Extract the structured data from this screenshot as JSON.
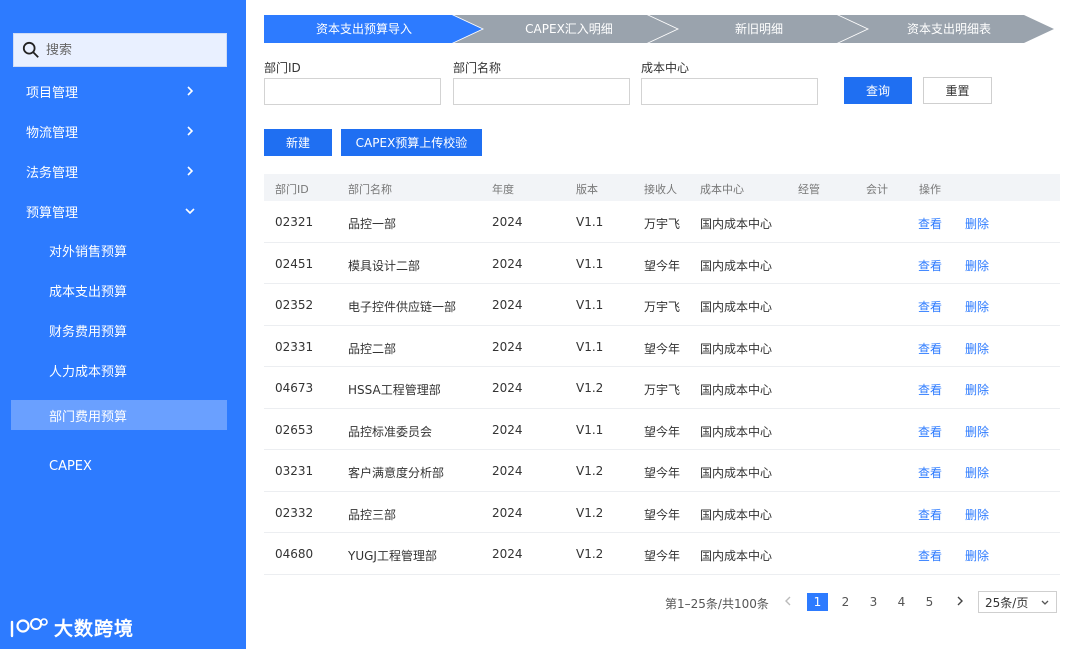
{
  "sidebar": {
    "search_placeholder": "搜索",
    "menu": [
      {
        "label": "项目管理"
      },
      {
        "label": "物流管理"
      },
      {
        "label": "法务管理"
      },
      {
        "label": "预算管理"
      }
    ],
    "sub_items": [
      {
        "label": "对外销售预算"
      },
      {
        "label": "成本支出预算"
      },
      {
        "label": "财务费用预算"
      },
      {
        "label": "人力成本预算"
      },
      {
        "label": "部门费用预算"
      },
      {
        "label": "CAPEX"
      }
    ],
    "brand": "大数跨境",
    "bg_color": "#2d7bff"
  },
  "steps": [
    {
      "label": "资本支出预算导入",
      "active": true
    },
    {
      "label": "CAPEX汇入明细",
      "active": false
    },
    {
      "label": "新旧明细",
      "active": false
    },
    {
      "label": "资本支出明细表",
      "active": false
    }
  ],
  "filters": {
    "dept_id_label": "部门ID",
    "dept_name_label": "部门名称",
    "cost_center_label": "成本中心",
    "dept_id_value": "",
    "dept_name_value": "",
    "cost_center_value": "",
    "query_label": "查询",
    "reset_label": "重置"
  },
  "actions": {
    "new_label": "新建",
    "upload_label": "CAPEX预算上传校验"
  },
  "table": {
    "headers": [
      "部门ID",
      "部门名称",
      "年度",
      "版本",
      "接收人",
      "成本中心",
      "经管",
      "会计",
      "操作"
    ],
    "view_label": "查看",
    "delete_label": "删除",
    "rows": [
      {
        "id": "02321",
        "name": "品控一部",
        "year": "2024",
        "version": "V1.1",
        "receiver": "万宇飞",
        "center": "国内成本中心"
      },
      {
        "id": "02451",
        "name": "模具设计二部",
        "year": "2024",
        "version": "V1.1",
        "receiver": "望今年",
        "center": "国内成本中心"
      },
      {
        "id": "02352",
        "name": "电子控件供应链一部",
        "year": "2024",
        "version": "V1.1",
        "receiver": "万宇飞",
        "center": "国内成本中心"
      },
      {
        "id": "02331",
        "name": "品控二部",
        "year": "2024",
        "version": "V1.1",
        "receiver": "望今年",
        "center": "国内成本中心"
      },
      {
        "id": "04673",
        "name": "HSSA工程管理部",
        "year": "2024",
        "version": "V1.2",
        "receiver": "万宇飞",
        "center": "国内成本中心"
      },
      {
        "id": "02653",
        "name": "品控标准委员会",
        "year": "2024",
        "version": "V1.1",
        "receiver": "望今年",
        "center": "国内成本中心"
      },
      {
        "id": "03231",
        "name": "客户满意度分析部",
        "year": "2024",
        "version": "V1.2",
        "receiver": "望今年",
        "center": "国内成本中心"
      },
      {
        "id": "02332",
        "name": "品控三部",
        "year": "2024",
        "version": "V1.2",
        "receiver": "望今年",
        "center": "国内成本中心"
      },
      {
        "id": "04680",
        "name": "YUGJ工程管理部",
        "year": "2024",
        "version": "V1.2",
        "receiver": "望今年",
        "center": "国内成本中心"
      }
    ]
  },
  "pagination": {
    "total_text": "第1–25条/共100条",
    "pages": [
      "1",
      "2",
      "3",
      "4",
      "5"
    ],
    "current": "1",
    "page_size": "25条/页"
  },
  "colors": {
    "primary": "#2d7bff",
    "button": "#1f6ff2",
    "step_inactive": "#9aa3ad",
    "active_sub_bg": "#6aa0ff"
  }
}
